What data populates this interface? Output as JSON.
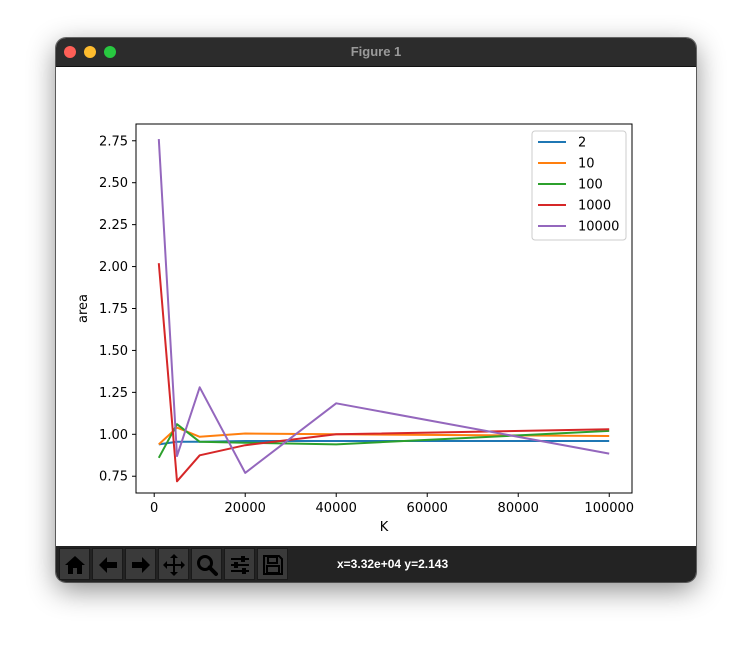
{
  "window": {
    "title": "Figure 1"
  },
  "toolbar": {
    "buttons": [
      {
        "name": "home-icon"
      },
      {
        "name": "back-arrow-icon"
      },
      {
        "name": "forward-arrow-icon"
      },
      {
        "name": "pan-move-icon"
      },
      {
        "name": "zoom-magnifier-icon"
      },
      {
        "name": "subplots-sliders-icon"
      },
      {
        "name": "save-floppy-icon"
      }
    ],
    "status": "x=3.32e+04 y=2.143"
  },
  "chart_data": {
    "type": "line",
    "title": "",
    "xlabel": "K",
    "ylabel": "area",
    "xlim": [
      -4000,
      105000
    ],
    "ylim": [
      0.65,
      2.85
    ],
    "xticks": [
      0,
      20000,
      40000,
      60000,
      80000,
      100000
    ],
    "yticks": [
      0.75,
      1.0,
      1.25,
      1.5,
      1.75,
      2.0,
      2.25,
      2.5,
      2.75
    ],
    "ytick_labels": [
      "0.75",
      "1.00",
      "1.25",
      "1.50",
      "1.75",
      "2.00",
      "2.25",
      "2.50",
      "2.75"
    ],
    "xtick_labels": [
      "0",
      "20000",
      "40000",
      "60000",
      "80000",
      "100000"
    ],
    "grid": false,
    "legend_position": "top-right",
    "x": [
      1000,
      5000,
      10000,
      20000,
      40000,
      100000
    ],
    "series": [
      {
        "name": "2",
        "color": "#1f77b4",
        "values": [
          0.94,
          0.955,
          0.955,
          0.96,
          0.96,
          0.96
        ]
      },
      {
        "name": "10",
        "color": "#ff7f0e",
        "values": [
          0.94,
          1.04,
          0.985,
          1.005,
          1.0,
          0.99
        ]
      },
      {
        "name": "100",
        "color": "#2ca02c",
        "values": [
          0.86,
          1.06,
          0.955,
          0.95,
          0.94,
          1.02
        ]
      },
      {
        "name": "1000",
        "color": "#d62728",
        "values": [
          2.02,
          0.72,
          0.875,
          0.935,
          1.0,
          1.03
        ]
      },
      {
        "name": "10000",
        "color": "#9467bd",
        "values": [
          2.76,
          0.87,
          1.28,
          0.77,
          1.185,
          0.885
        ]
      }
    ]
  }
}
